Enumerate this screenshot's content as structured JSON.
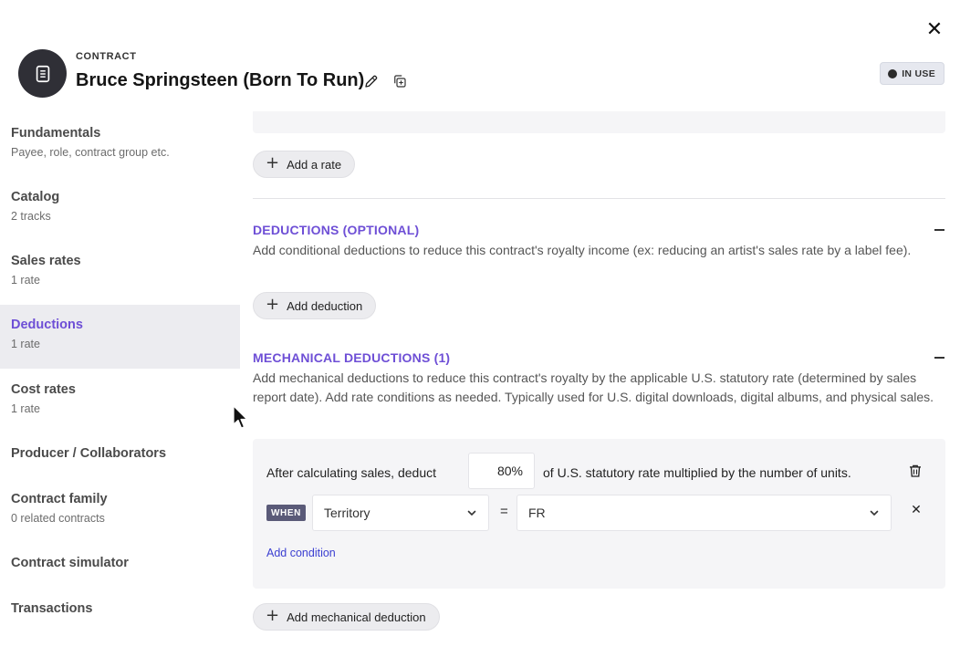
{
  "header": {
    "kicker": "CONTRACT",
    "title": "Bruce Springsteen (Born To Run)",
    "status_badge": "IN USE",
    "icons": {
      "avatar": "document-icon",
      "edit": "pencil-icon",
      "copy": "copy-icon",
      "close": "close-icon"
    }
  },
  "close_glyph": "✕",
  "sidebar": {
    "items": [
      {
        "label": "Fundamentals",
        "sub": "Payee, role, contract group etc."
      },
      {
        "label": "Catalog",
        "sub": "2 tracks"
      },
      {
        "label": "Sales rates",
        "sub": "1 rate"
      },
      {
        "label": "Deductions",
        "sub": "1 rate",
        "active": true
      },
      {
        "label": "Cost rates",
        "sub": "1 rate"
      },
      {
        "label": "Producer / Collaborators"
      },
      {
        "label": "Contract family",
        "sub": "0 related contracts"
      },
      {
        "label": "Contract simulator"
      },
      {
        "label": "Transactions"
      }
    ]
  },
  "main": {
    "add_rate_label": "Add a rate",
    "deductions": {
      "title": "DEDUCTIONS (OPTIONAL)",
      "description": "Add conditional deductions to reduce this contract's royalty income (ex: reducing an artist's sales rate by a label fee).",
      "add_label": "Add deduction"
    },
    "mechanical": {
      "title": "MECHANICAL DEDUCTIONS (1)",
      "description": "Add mechanical deductions to reduce this contract's royalty by the applicable U.S. statutory rate (determined by sales report date). Add rate conditions as needed. Typically used for U.S. digital downloads, digital albums, and physical sales.",
      "rule": {
        "prefix": "After calculating sales, deduct",
        "percent": "80",
        "percent_unit": "%",
        "suffix": "of U.S. statutory rate multiplied by the number of units.",
        "when_label": "WHEN",
        "condition_field": "Territory",
        "operator": "=",
        "condition_value": "FR",
        "add_condition_label": "Add condition"
      },
      "add_label": "Add mechanical deduction"
    }
  },
  "glyphs": {
    "plus": "+",
    "remove": "✕"
  },
  "colors": {
    "accent": "#6e4fd6",
    "link": "#3b3fd1",
    "avatar_bg": "#2f2f36"
  }
}
